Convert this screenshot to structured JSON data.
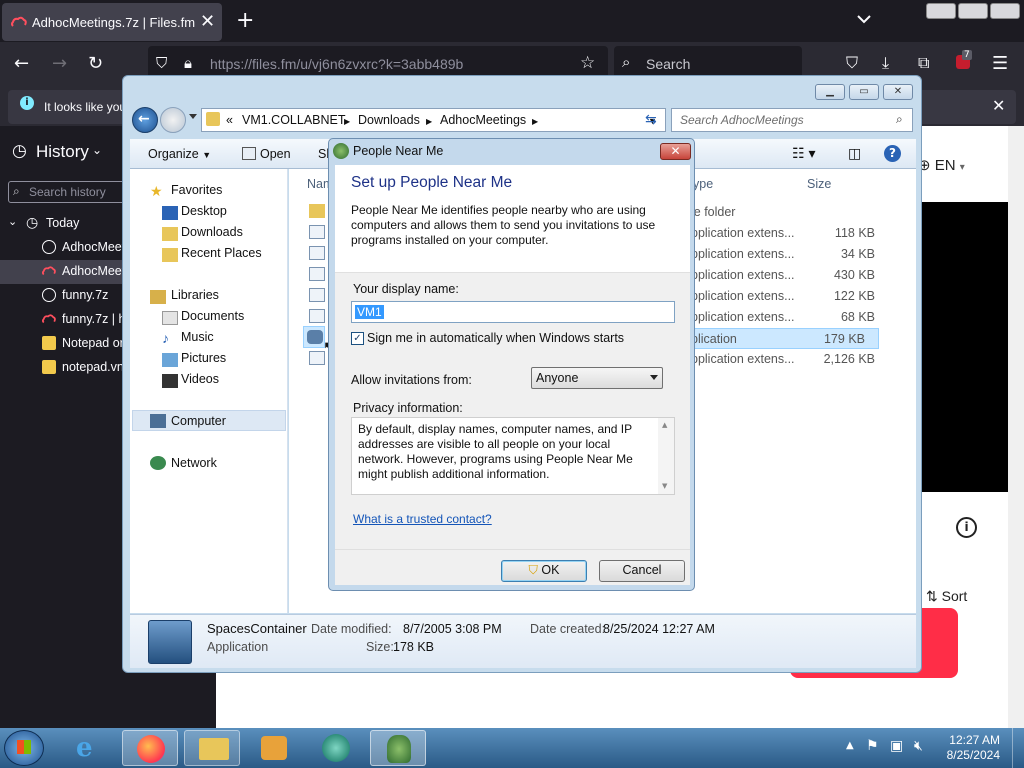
{
  "browser": {
    "tab_title": "AdhocMeetings.7z | Files.fm",
    "url": "https://files.fm/u/vj6n6zvxrc?k=3abb489b",
    "search_placeholder": "Search",
    "notification_text": "It looks like you",
    "extension_badge": "7"
  },
  "history_panel": {
    "title": "History",
    "search_placeholder": "Search history",
    "group": "Today",
    "items": [
      "AdhocMeet",
      "AdhocMeet",
      "funny.7z",
      "funny.7z | h",
      "Notepad or",
      "notepad.vn"
    ]
  },
  "page": {
    "lang": "EN",
    "sort": "Sort"
  },
  "explorer": {
    "breadcrumb": [
      "VM1.COLLABNET",
      "Downloads",
      "AdhocMeetings"
    ],
    "search_placeholder": "Search AdhocMeetings",
    "toolbar": {
      "organize": "Organize",
      "open": "Open",
      "share_partial": "Sh"
    },
    "nav": {
      "favorites": "Favorites",
      "favorites_items": [
        "Desktop",
        "Downloads",
        "Recent Places"
      ],
      "libraries": "Libraries",
      "libraries_items": [
        "Documents",
        "Music",
        "Pictures",
        "Videos"
      ],
      "computer": "Computer",
      "network": "Network"
    },
    "columns": {
      "name_partial": "Nam",
      "type_partial": "ype",
      "size": "Size"
    },
    "rows": [
      {
        "type": "le folder",
        "size": ""
      },
      {
        "type": "pplication extens...",
        "size": "118 KB"
      },
      {
        "type": "pplication extens...",
        "size": "34 KB"
      },
      {
        "type": "pplication extens...",
        "size": "430 KB"
      },
      {
        "type": "pplication extens...",
        "size": "122 KB"
      },
      {
        "type": "pplication extens...",
        "size": "68 KB"
      },
      {
        "type": "plication",
        "size": "179 KB"
      },
      {
        "type": "pplication extens...",
        "size": "2,126 KB"
      }
    ],
    "details": {
      "name": "SpacesContainer",
      "kind": "Application",
      "modified_label": "Date modified:",
      "modified_value": "8/7/2005 3:08 PM",
      "created_label": "Date created:",
      "created_value": "8/25/2024 12:27 AM",
      "size_label": "Size:",
      "size_value": "178 KB"
    }
  },
  "dialog": {
    "title": "People Near Me",
    "heading": "Set up People Near Me",
    "description": "People Near Me identifies people nearby who are using computers and allows them to send you invitations to use programs installed on your computer.",
    "display_name_label": "Your display name:",
    "display_name_value": "VM1",
    "signin_label": "Sign me in automatically when Windows starts",
    "invitations_label": "Allow invitations from:",
    "invitations_value": "Anyone",
    "privacy_label": "Privacy information:",
    "privacy_text": "By default, display names, computer names, and IP addresses are visible to all people on your local network. However, programs using People Near Me might publish additional information.",
    "trusted_link": "What is a trusted contact?",
    "ok": "OK",
    "cancel": "Cancel"
  },
  "taskbar": {
    "time": "12:27 AM",
    "date": "8/25/2024"
  }
}
